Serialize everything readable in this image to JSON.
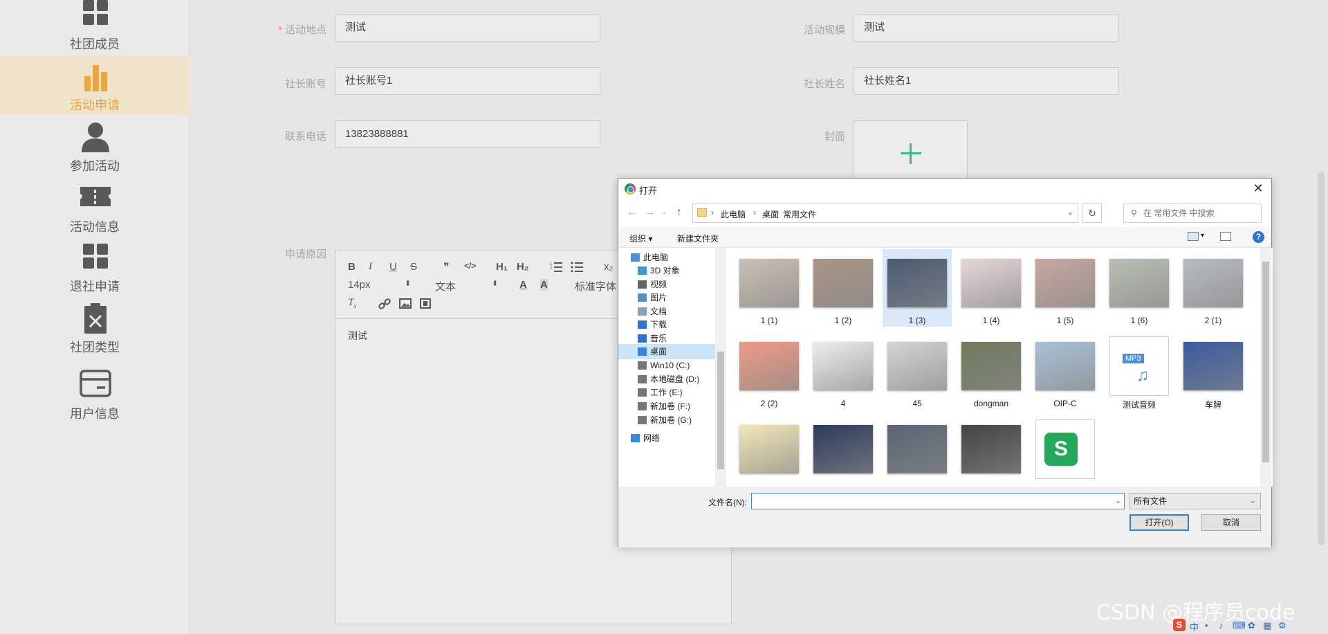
{
  "sidebar": {
    "items": [
      {
        "label": "社团成员",
        "icon": "grid-icon"
      },
      {
        "label": "活动申请",
        "icon": "bar-chart-icon",
        "active": true
      },
      {
        "label": "参加活动",
        "icon": "user-icon"
      },
      {
        "label": "活动信息",
        "icon": "ticket-icon"
      },
      {
        "label": "退社申请",
        "icon": "grid-icon"
      },
      {
        "label": "社团类型",
        "icon": "clipboard-x-icon"
      },
      {
        "label": "用户信息",
        "icon": "card-icon"
      }
    ]
  },
  "form": {
    "location_label": "活动地点",
    "location_required": "*",
    "location_value": "测试",
    "scale_label": "活动规模",
    "scale_value": "测试",
    "leader_account_label": "社长账号",
    "leader_account_value": "社长账号1",
    "leader_name_label": "社长姓名",
    "leader_name_value": "社长姓名1",
    "phone_label": "联系电话",
    "phone_value": "13823888881",
    "cover_label": "封面",
    "reason_label": "申请原因",
    "editor": {
      "bold": "B",
      "italic": "I",
      "underline": "U",
      "strike": "S",
      "quote": "❞",
      "code": "</>",
      "h1": "H₁",
      "h2": "H₂",
      "subscript": "x₂",
      "font_size": "14px",
      "block_type": "文本",
      "font_family": "标准字体",
      "content": "测试"
    }
  },
  "dialog": {
    "title": "打开",
    "close": "✕",
    "breadcrumb": [
      "此电脑",
      "桌面",
      "常用文件"
    ],
    "search_placeholder": "在 常用文件 中搜索",
    "organize": "组织 ▾",
    "new_folder": "新建文件夹",
    "help": "?",
    "tree": [
      {
        "label": "此电脑",
        "icon": "pc-icon"
      },
      {
        "label": "3D 对象",
        "icon": "cube-icon"
      },
      {
        "label": "视频",
        "icon": "video-icon"
      },
      {
        "label": "图片",
        "icon": "picture-icon"
      },
      {
        "label": "文档",
        "icon": "document-icon"
      },
      {
        "label": "下载",
        "icon": "download-icon"
      },
      {
        "label": "音乐",
        "icon": "music-icon"
      },
      {
        "label": "桌面",
        "icon": "desktop-icon",
        "selected": true
      },
      {
        "label": "Win10 (C:)",
        "icon": "drive-icon"
      },
      {
        "label": "本地磁盘 (D:)",
        "icon": "drive-icon"
      },
      {
        "label": "工作 (E:)",
        "icon": "drive-icon"
      },
      {
        "label": "新加卷 (F:)",
        "icon": "drive-icon"
      },
      {
        "label": "新加卷 (G:)",
        "icon": "drive-icon"
      },
      {
        "label": "网络",
        "icon": "network-icon"
      }
    ],
    "files": [
      {
        "name": "1 (1)",
        "icon": "cat-photo-icon",
        "color": "#cbbfb2"
      },
      {
        "name": "1 (2)",
        "icon": "tea-set-photo-icon",
        "color": "#a89587"
      },
      {
        "name": "1 (3)",
        "icon": "house-photo-icon",
        "color": "#4b5b73",
        "selected": true
      },
      {
        "name": "1 (4)",
        "icon": "girl-photo-icon",
        "color": "#e8d6d8"
      },
      {
        "name": "1 (5)",
        "icon": "girl-photo-icon",
        "color": "#c7a79f"
      },
      {
        "name": "1 (6)",
        "icon": "girl-photo-icon",
        "color": "#b9bfb4"
      },
      {
        "name": "2 (1)",
        "icon": "car-photo-icon",
        "color": "#b8bcc2"
      },
      {
        "name": "2 (2)",
        "icon": "peach-photo-icon",
        "color": "#ef9a86"
      },
      {
        "name": "4",
        "icon": "document-photo-icon",
        "color": "#eeeeee"
      },
      {
        "name": "45",
        "icon": "girl-photo-icon",
        "color": "#d7d3d6"
      },
      {
        "name": "dongman",
        "icon": "film-photo-icon",
        "color": "#6f7a5d"
      },
      {
        "name": "OIP-C",
        "icon": "building-photo-icon",
        "color": "#a9c1d7"
      },
      {
        "name": "测试音频",
        "icon": "mp3-file-icon",
        "color": "#ffffff",
        "badge": "MP3"
      },
      {
        "name": "车牌",
        "icon": "car-photo-icon",
        "color": "#3a5aa0"
      },
      {
        "name": "",
        "icon": "cartoon-photo-icon",
        "color": "#f2e6b8"
      },
      {
        "name": "",
        "icon": "ppt-photo-icon",
        "color": "#2d3b5c"
      },
      {
        "name": "",
        "icon": "car-photo-icon",
        "color": "#5a6575"
      },
      {
        "name": "",
        "icon": "gpu-photo-icon",
        "color": "#444444"
      },
      {
        "name": "",
        "icon": "wps-file-icon",
        "color": "#ffffff",
        "badge": "S"
      }
    ],
    "filename_label": "文件名(N):",
    "filename_value": "",
    "file_type": "所有文件",
    "open_button": "打开(O)",
    "cancel_button": "取消"
  },
  "watermark": "CSDN @程序员code",
  "tray": {
    "ime": "S",
    "lang": "中"
  }
}
